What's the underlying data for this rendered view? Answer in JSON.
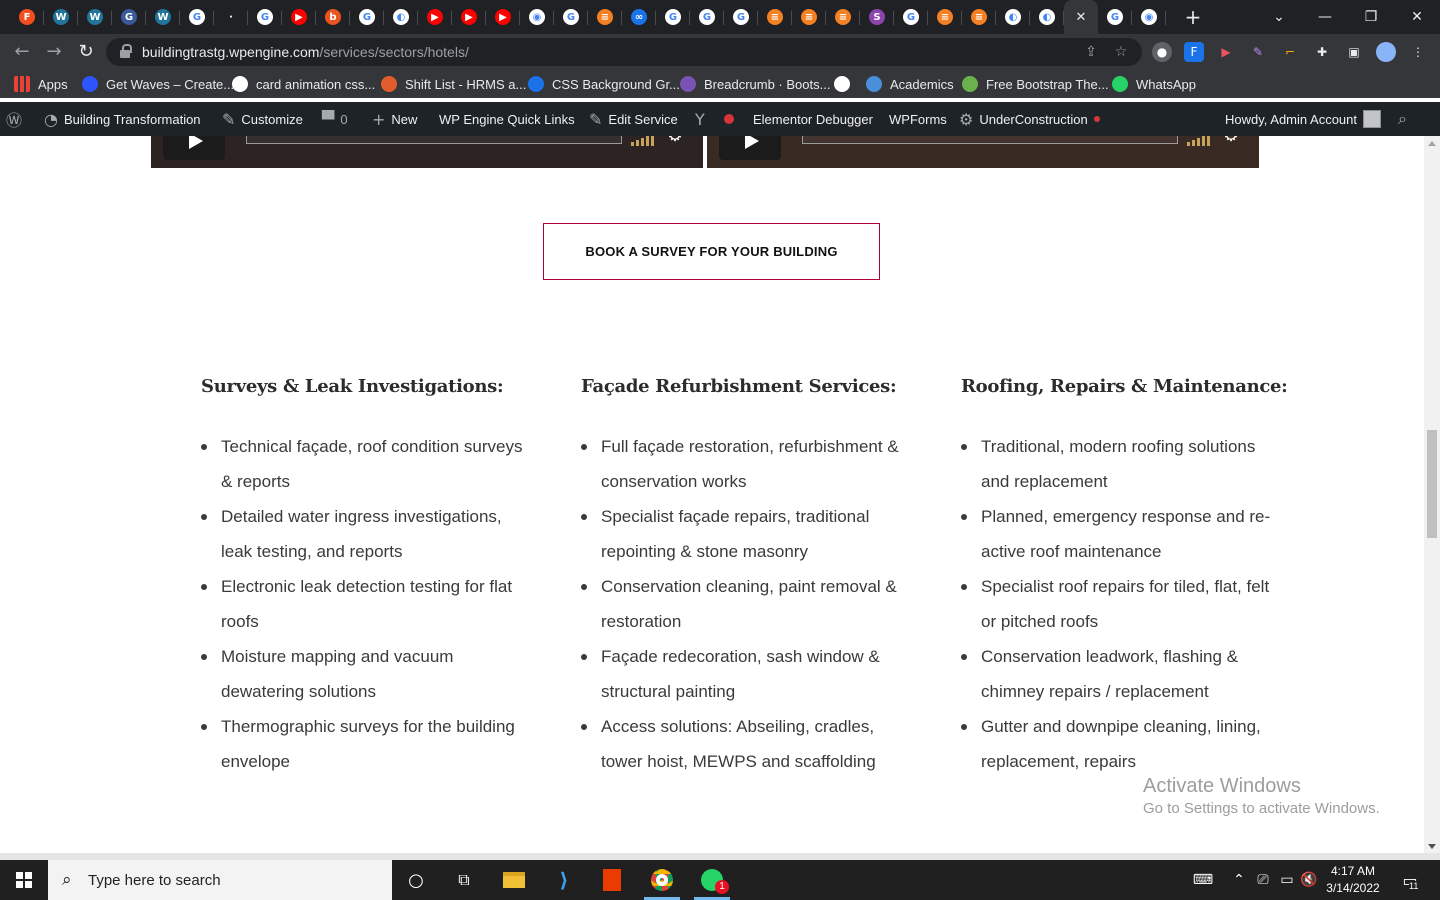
{
  "browser": {
    "tabs": [
      {
        "icon": "figma-icon",
        "color": "#f24e1e",
        "glyph": "F"
      },
      {
        "icon": "wordpress-icon",
        "color": "#21759b",
        "glyph": "W"
      },
      {
        "icon": "wordpress-icon",
        "color": "#21759b",
        "glyph": "W"
      },
      {
        "icon": "site-icon",
        "color": "#3b5998",
        "glyph": "G"
      },
      {
        "icon": "wordpress-icon",
        "color": "#21759b",
        "glyph": "W"
      },
      {
        "icon": "google-icon",
        "color": "#ffffff",
        "glyph": "G"
      },
      {
        "icon": "site-icon",
        "color": "#202124",
        "glyph": "·"
      },
      {
        "icon": "google-icon",
        "color": "#ffffff",
        "glyph": "G"
      },
      {
        "icon": "youtube-icon",
        "color": "#ff0000",
        "glyph": "▶"
      },
      {
        "icon": "site-icon",
        "color": "#e95420",
        "glyph": "b"
      },
      {
        "icon": "google-icon",
        "color": "#ffffff",
        "glyph": "G"
      },
      {
        "icon": "globe-icon",
        "color": "#ffffff",
        "glyph": "◐"
      },
      {
        "icon": "youtube-icon",
        "color": "#ff0000",
        "glyph": "▶"
      },
      {
        "icon": "youtube-icon",
        "color": "#ff0000",
        "glyph": "▶"
      },
      {
        "icon": "youtube-icon",
        "color": "#ff0000",
        "glyph": "▶"
      },
      {
        "icon": "chrome-icon",
        "color": "#ffffff",
        "glyph": "◉"
      },
      {
        "icon": "google-icon",
        "color": "#ffffff",
        "glyph": "G"
      },
      {
        "icon": "stackoverflow-icon",
        "color": "#f48024",
        "glyph": "≡"
      },
      {
        "icon": "site-icon",
        "color": "#1a73e8",
        "glyph": "∞"
      },
      {
        "icon": "google-icon",
        "color": "#ffffff",
        "glyph": "G"
      },
      {
        "icon": "google-icon",
        "color": "#ffffff",
        "glyph": "G"
      },
      {
        "icon": "google-icon",
        "color": "#ffffff",
        "glyph": "G"
      },
      {
        "icon": "stackoverflow-icon",
        "color": "#f48024",
        "glyph": "≡"
      },
      {
        "icon": "stackoverflow-icon",
        "color": "#f48024",
        "glyph": "≡"
      },
      {
        "icon": "stackoverflow-icon",
        "color": "#f48024",
        "glyph": "≡"
      },
      {
        "icon": "site-icon",
        "color": "#8e44ad",
        "glyph": "S"
      },
      {
        "icon": "google-icon",
        "color": "#ffffff",
        "glyph": "G"
      },
      {
        "icon": "stackoverflow-icon",
        "color": "#f48024",
        "glyph": "≡"
      },
      {
        "icon": "stackoverflow-icon",
        "color": "#f48024",
        "glyph": "≡"
      },
      {
        "icon": "globe-icon",
        "color": "#ffffff",
        "glyph": "◐"
      },
      {
        "icon": "globe-icon",
        "color": "#ffffff",
        "glyph": "◐"
      },
      {
        "icon": "close-icon",
        "color": "#35363a",
        "glyph": "✕",
        "active": true
      },
      {
        "icon": "google-icon",
        "color": "#ffffff",
        "glyph": "G"
      },
      {
        "icon": "chrome-icon",
        "color": "#ffffff",
        "glyph": "◉"
      }
    ],
    "url_host": "buildingtrastg.wpengine.com",
    "url_path": "/services/sectors/hotels/",
    "bookmarks": [
      {
        "label": "Apps",
        "icon": "apps-grid-icon",
        "color": "#4285f4"
      },
      {
        "label": "Get Waves – Create...",
        "icon": "waves-icon",
        "color": "#2d55ff"
      },
      {
        "label": "card animation css...",
        "icon": "google-icon",
        "color": "#ffffff"
      },
      {
        "label": "Shift List - HRMS a...",
        "icon": "hrms-icon",
        "color": "#e35d2c"
      },
      {
        "label": "CSS Background Gr...",
        "icon": "css-icon",
        "color": "#1a73e8"
      },
      {
        "label": "Breadcrumb · Boots...",
        "icon": "bootstrap-icon",
        "color": "#7952b3"
      },
      {
        "label": "",
        "icon": "globe-icon",
        "color": "#ffffff"
      },
      {
        "label": "Academics",
        "icon": "academics-icon",
        "color": "#4a90d9"
      },
      {
        "label": "Free Bootstrap The...",
        "icon": "leaf-icon",
        "color": "#6ab04c"
      },
      {
        "label": "WhatsApp",
        "icon": "whatsapp-icon",
        "color": "#25d366"
      }
    ]
  },
  "wpadmin": {
    "site_name": "Building Transformation",
    "customize": "Customize",
    "comments_count": "0",
    "new": "New",
    "quick_links": "WP Engine Quick Links",
    "edit_service": "Edit Service",
    "debugger": "Elementor Debugger",
    "wpforms": "WPForms",
    "under_construction": "UnderConstruction",
    "howdy": "Howdy, Admin Account"
  },
  "page": {
    "cta_label": "BOOK A SURVEY FOR YOUR BUILDING",
    "columns": [
      {
        "title": "Surveys & Leak Investigations:",
        "items": [
          "Technical façade, roof condition surveys & reports",
          "Detailed water ingress investigations, leak testing, and reports",
          "Electronic leak detection testing for flat roofs",
          "Moisture mapping and vacuum dewatering solutions",
          "Thermographic surveys for the building envelope"
        ]
      },
      {
        "title": "Façade Refurbishment Services:",
        "items": [
          "Full façade restoration, refurbishment & conservation works",
          "Specialist façade repairs, traditional repointing & stone masonry",
          "Conservation cleaning, paint removal & restoration",
          "Façade redecoration, sash window & structural painting",
          "Access solutions: Abseiling, cradles, tower hoist, MEWPS and scaffolding"
        ]
      },
      {
        "title": "Roofing, Repairs & Maintenance:",
        "items": [
          "Traditional, modern roofing solutions and replacement",
          "Planned, emergency response and re-active roof maintenance",
          "Specialist roof repairs for tiled, flat, felt or pitched roofs",
          "Conservation leadwork, flashing & chimney repairs / replacement",
          "Gutter and downpipe cleaning, lining, replacement, repairs"
        ]
      }
    ],
    "watermark_title": "Activate Windows",
    "watermark_sub": "Go to Settings to activate Windows."
  },
  "taskbar": {
    "search_placeholder": "Type here to search",
    "time": "4:17 AM",
    "date": "3/14/2022",
    "whatsapp_badge": "1",
    "notification_count": "11"
  },
  "colors": {
    "cta_border": "#b0003a",
    "wp_bar": "#1d2327",
    "chrome_dark": "#202124",
    "taskbar": "#202020"
  }
}
